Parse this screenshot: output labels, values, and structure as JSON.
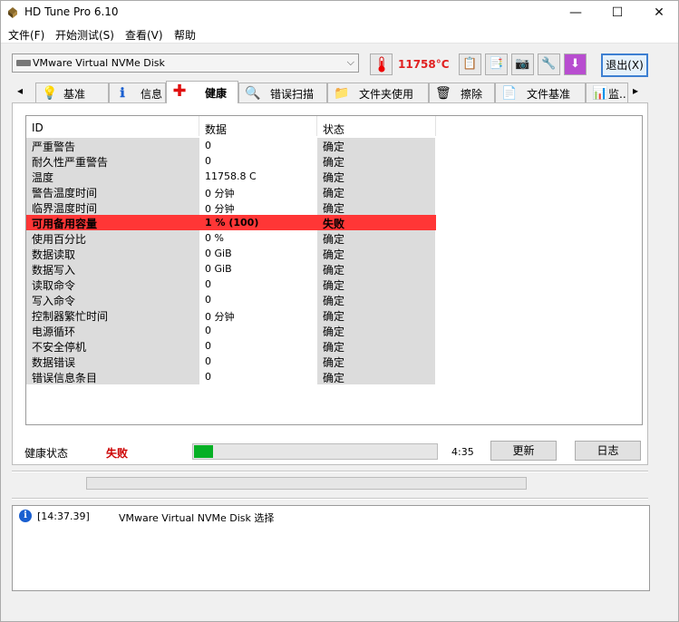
{
  "window": {
    "title": "HD Tune Pro 6.10",
    "controls": {
      "minimize": "—",
      "maximize": "☐",
      "close": "✕"
    }
  },
  "menu": [
    "文件(F)",
    "开始测试(S)",
    "查看(V)",
    "帮助"
  ],
  "toolbar": {
    "drive": "VMware Virtual NVMe Disk",
    "temperature": "11758°C",
    "exit_label": "退出(X)",
    "icons": [
      "thermometer-icon",
      "copy-text-icon",
      "copy-screenshot-icon",
      "camera-icon",
      "options-icon",
      "save-icon"
    ]
  },
  "tabs": [
    {
      "label": "基准",
      "icon": "info-bulb-icon",
      "glyph": "💡"
    },
    {
      "label": "信息",
      "icon": "info-icon",
      "glyph": "ℹ"
    },
    {
      "label": "健康",
      "icon": "health-cross-icon",
      "glyph": "✚",
      "active": true
    },
    {
      "label": "错误扫描",
      "icon": "search-icon",
      "glyph": "🔍"
    },
    {
      "label": "文件夹使用",
      "icon": "folder-icon",
      "glyph": "📁"
    },
    {
      "label": "擦除",
      "icon": "trash-icon",
      "glyph": "🗑"
    },
    {
      "label": "文件基准",
      "icon": "file-bench-icon",
      "glyph": "📄"
    },
    {
      "label": "监..",
      "icon": "monitor-icon",
      "glyph": "📊"
    }
  ],
  "health_table": {
    "headers": [
      "ID",
      "数据",
      "状态"
    ],
    "rows": [
      {
        "id": "严重警告",
        "data": "0",
        "status": "确定"
      },
      {
        "id": "耐久性严重警告",
        "data": "0",
        "status": "确定"
      },
      {
        "id": "温度",
        "data": "11758.8 C",
        "status": "确定"
      },
      {
        "id": "警告温度时间",
        "data": "0 分钟",
        "status": "确定"
      },
      {
        "id": "临界温度时间",
        "data": "0 分钟",
        "status": "确定"
      },
      {
        "id": "可用备用容量",
        "data": "1 % (100)",
        "status": "失败",
        "fail": true
      },
      {
        "id": "使用百分比",
        "data": "0 %",
        "status": "确定"
      },
      {
        "id": "数据读取",
        "data": "0 GiB",
        "status": "确定"
      },
      {
        "id": "数据写入",
        "data": "0 GiB",
        "status": "确定"
      },
      {
        "id": "读取命令",
        "data": "0",
        "status": "确定"
      },
      {
        "id": "写入命令",
        "data": "0",
        "status": "确定"
      },
      {
        "id": "控制器繁忙时间",
        "data": "0 分钟",
        "status": "确定"
      },
      {
        "id": "电源循环",
        "data": "0",
        "status": "确定"
      },
      {
        "id": "不安全停机",
        "data": "0",
        "status": "确定"
      },
      {
        "id": "数据错误",
        "data": "0",
        "status": "确定"
      },
      {
        "id": "错误信息条目",
        "data": "0",
        "status": "确定"
      }
    ]
  },
  "health_status": {
    "label": "健康状态",
    "value": "失败",
    "progress_fraction": 0.08,
    "time": "4:35",
    "refresh_label": "更新",
    "log_label": "日志"
  },
  "log": {
    "entries": [
      {
        "time": "[14:37.39]",
        "message": "VMware Virtual NVMe Disk 选择"
      }
    ]
  },
  "colors": {
    "fail_row": "#ff3636",
    "fail_text": "#cc0000",
    "temp_text": "#e02020",
    "progress": "#06b025"
  }
}
